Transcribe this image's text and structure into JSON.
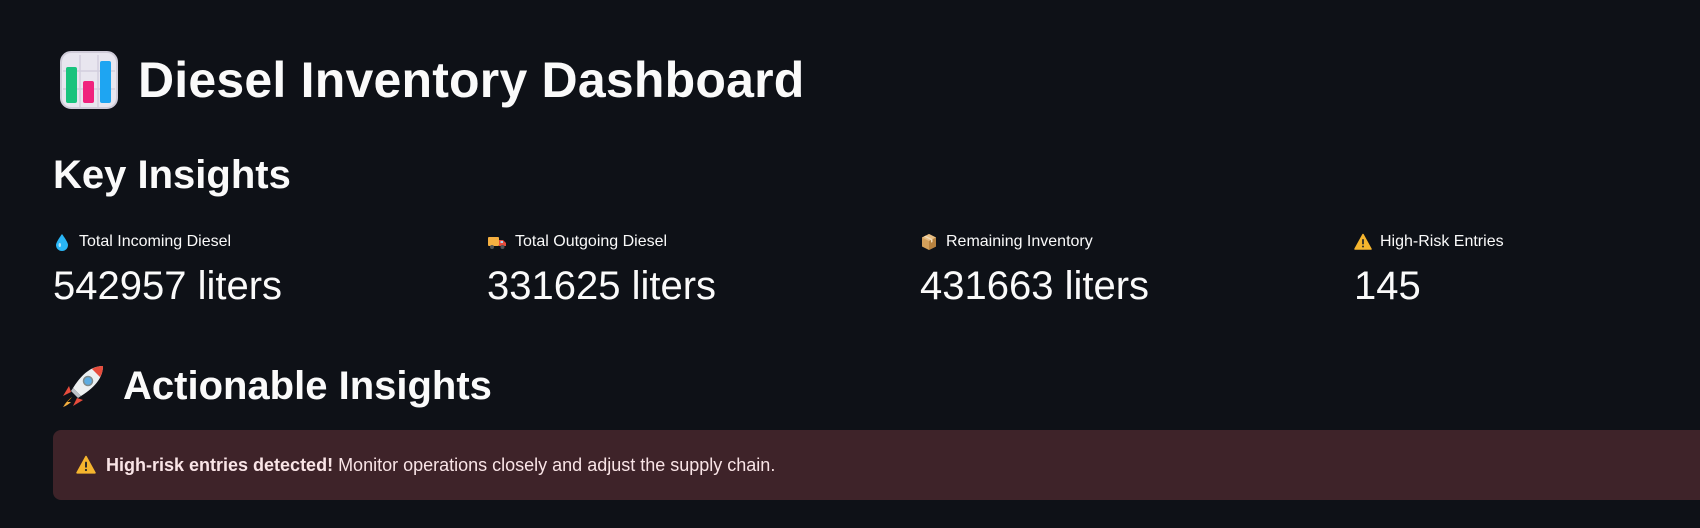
{
  "header": {
    "title": "Diesel Inventory Dashboard",
    "icon": "bar-chart-emoji-icon"
  },
  "key_insights": {
    "title": "Key Insights",
    "metrics": [
      {
        "icon": "droplet-icon",
        "label": "Total Incoming Diesel",
        "value": "542957 liters"
      },
      {
        "icon": "delivery-truck-icon",
        "label": "Total Outgoing Diesel",
        "value": "331625 liters"
      },
      {
        "icon": "package-icon",
        "label": "Remaining Inventory",
        "value": "431663 liters"
      },
      {
        "icon": "warning-icon",
        "label": "High-Risk Entries",
        "value": "145"
      }
    ]
  },
  "actionable": {
    "icon": "rocket-icon",
    "title": "Actionable Insights",
    "alert": {
      "icon": "warning-icon",
      "strong": "High-risk entries detected!",
      "text": " Monitor operations closely and adjust the supply chain."
    }
  },
  "colors": {
    "background": "#0e1117",
    "text": "#fafafa",
    "alert_background": "#3e2329",
    "alert_text": "#f9e4e6"
  }
}
